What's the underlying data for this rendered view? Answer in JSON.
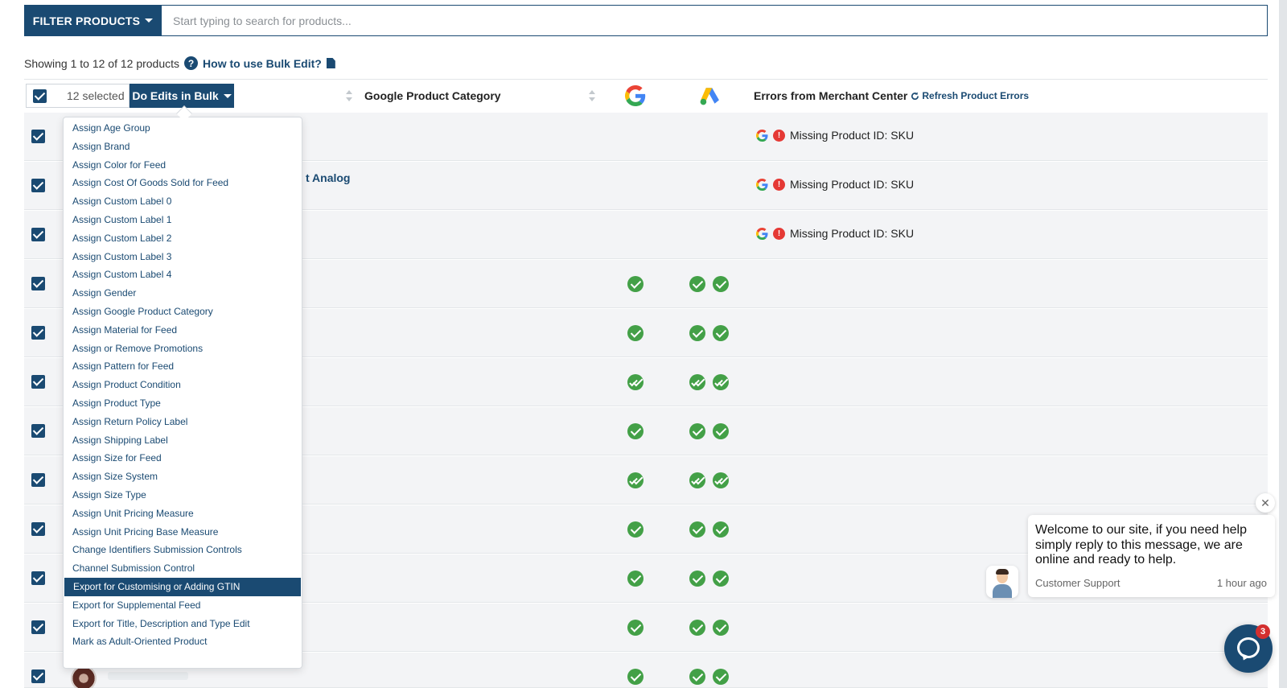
{
  "search": {
    "filter_label": "FILTER PRODUCTS",
    "placeholder": "Start typing to search for products..."
  },
  "summary": {
    "showing_text": "Showing 1 to 12 of 12 products",
    "help_link": "How to use Bulk Edit?"
  },
  "table": {
    "selected_label": "12 selected",
    "bulk_button_label": "Do Edits in Bulk",
    "columns": {
      "category": "Google Product Category",
      "errors": "Errors from Merchant Center",
      "refresh": "Refresh Product Errors"
    },
    "rows": [
      {
        "name": "",
        "google": "error",
        "ads": [
          "error",
          "error"
        ],
        "error_text": "Missing Product ID: SKU"
      },
      {
        "name": "t Analog",
        "google": "error",
        "ads": [
          "error",
          "error"
        ],
        "error_text": "Missing Product ID: SKU"
      },
      {
        "name": "",
        "google": "error",
        "ads": [
          "error",
          "error"
        ],
        "error_text": "Missing Product ID: SKU"
      },
      {
        "name": "",
        "google": "ok",
        "ads": [
          "ok",
          "ok"
        ],
        "error_text": ""
      },
      {
        "name": "",
        "google": "ok",
        "ads": [
          "ok",
          "ok"
        ],
        "error_text": ""
      },
      {
        "name": "",
        "google": "ok2",
        "ads": [
          "ok2",
          "ok2"
        ],
        "error_text": ""
      },
      {
        "name": "",
        "google": "ok",
        "ads": [
          "ok",
          "ok"
        ],
        "error_text": ""
      },
      {
        "name": "",
        "google": "ok2",
        "ads": [
          "ok2",
          "ok2"
        ],
        "error_text": ""
      },
      {
        "name": "",
        "google": "ok",
        "ads": [
          "ok",
          "ok"
        ],
        "error_text": ""
      },
      {
        "name": "",
        "google": "ok",
        "ads": [
          "ok",
          "ok"
        ],
        "error_text": ""
      },
      {
        "name": "",
        "google": "ok",
        "ads": [
          "ok",
          "ok"
        ],
        "error_text": ""
      },
      {
        "name": "",
        "google": "ok",
        "ads": [
          "ok",
          "ok"
        ],
        "error_text": ""
      }
    ]
  },
  "bulk_menu": {
    "items": [
      "Assign Age Group",
      "Assign Brand",
      "Assign Color for Feed",
      "Assign Cost Of Goods Sold for Feed",
      "Assign Custom Label 0",
      "Assign Custom Label 1",
      "Assign Custom Label 2",
      "Assign Custom Label 3",
      "Assign Custom Label 4",
      "Assign Gender",
      "Assign Google Product Category",
      "Assign Material for Feed",
      "Assign or Remove Promotions",
      "Assign Pattern for Feed",
      "Assign Product Condition",
      "Assign Product Type",
      "Assign Return Policy Label",
      "Assign Shipping Label",
      "Assign Size for Feed",
      "Assign Size System",
      "Assign Size Type",
      "Assign Unit Pricing Measure",
      "Assign Unit Pricing Base Measure",
      "Change Identifiers Submission Controls",
      "Channel Submission Control",
      "Export for Customising or Adding GTIN",
      "Export for Supplemental Feed",
      "Export for Title, Description and Type Edit",
      "Mark as Adult-Oriented Product"
    ],
    "active_index": 25
  },
  "chat": {
    "message": "Welcome to our site, if you need help simply reply to this message, we are online and ready to help.",
    "sender": "Customer Support",
    "time": "1 hour ago",
    "badge": "3"
  },
  "colors": {
    "primary": "#1a4a72",
    "error": "#e53935",
    "success": "#43a047"
  },
  "icons": [
    "caret-down-icon",
    "help-icon",
    "document-icon",
    "google-icon",
    "google-ads-icon",
    "refresh-icon",
    "error-icon",
    "check-icon",
    "double-check-icon",
    "close-icon",
    "chat-icon"
  ]
}
